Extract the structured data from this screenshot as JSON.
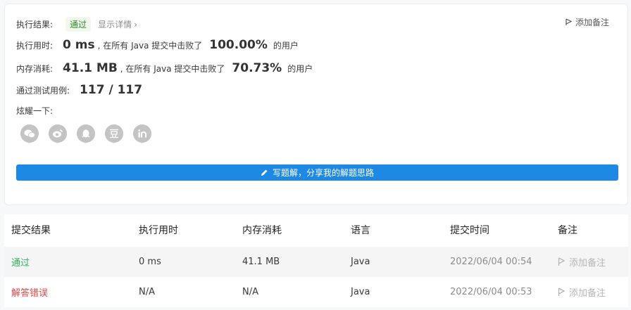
{
  "result": {
    "label": "执行结果:",
    "status": "通过",
    "details_link": "显示详情",
    "add_note": "添加备注"
  },
  "runtime": {
    "label": "执行用时:",
    "value": "0 ms",
    "middle": ", 在所有 Java 提交中击败了",
    "percent": "100.00%",
    "suffix": "的用户"
  },
  "memory": {
    "label": "内存消耗:",
    "value": "41.1 MB",
    "middle": ", 在所有 Java 提交中击败了",
    "percent": "70.73%",
    "suffix": "的用户"
  },
  "testcases": {
    "label": "通过测试用例:",
    "value": "117 / 117"
  },
  "share": {
    "label": "炫耀一下:",
    "icons": [
      "wechat-icon",
      "weibo-icon",
      "qq-icon",
      "douban-icon",
      "linkedin-icon"
    ]
  },
  "write_solution_button": "写题解，分享我的解题思路",
  "table": {
    "headers": [
      "提交结果",
      "执行用时",
      "内存消耗",
      "语言",
      "提交时间",
      "备注"
    ],
    "rows": [
      {
        "result": "通过",
        "runtime": "0 ms",
        "memory": "41.1 MB",
        "language": "Java",
        "time": "2022/06/04 00:54",
        "note": "添加备注"
      },
      {
        "result": "解答错误",
        "runtime": "N/A",
        "memory": "N/A",
        "language": "Java",
        "time": "2022/06/04 00:53",
        "note": "添加备注"
      }
    ]
  },
  "colors": {
    "accent": "#1e88e5",
    "pass": "#2db55d",
    "error": "#e94545"
  }
}
